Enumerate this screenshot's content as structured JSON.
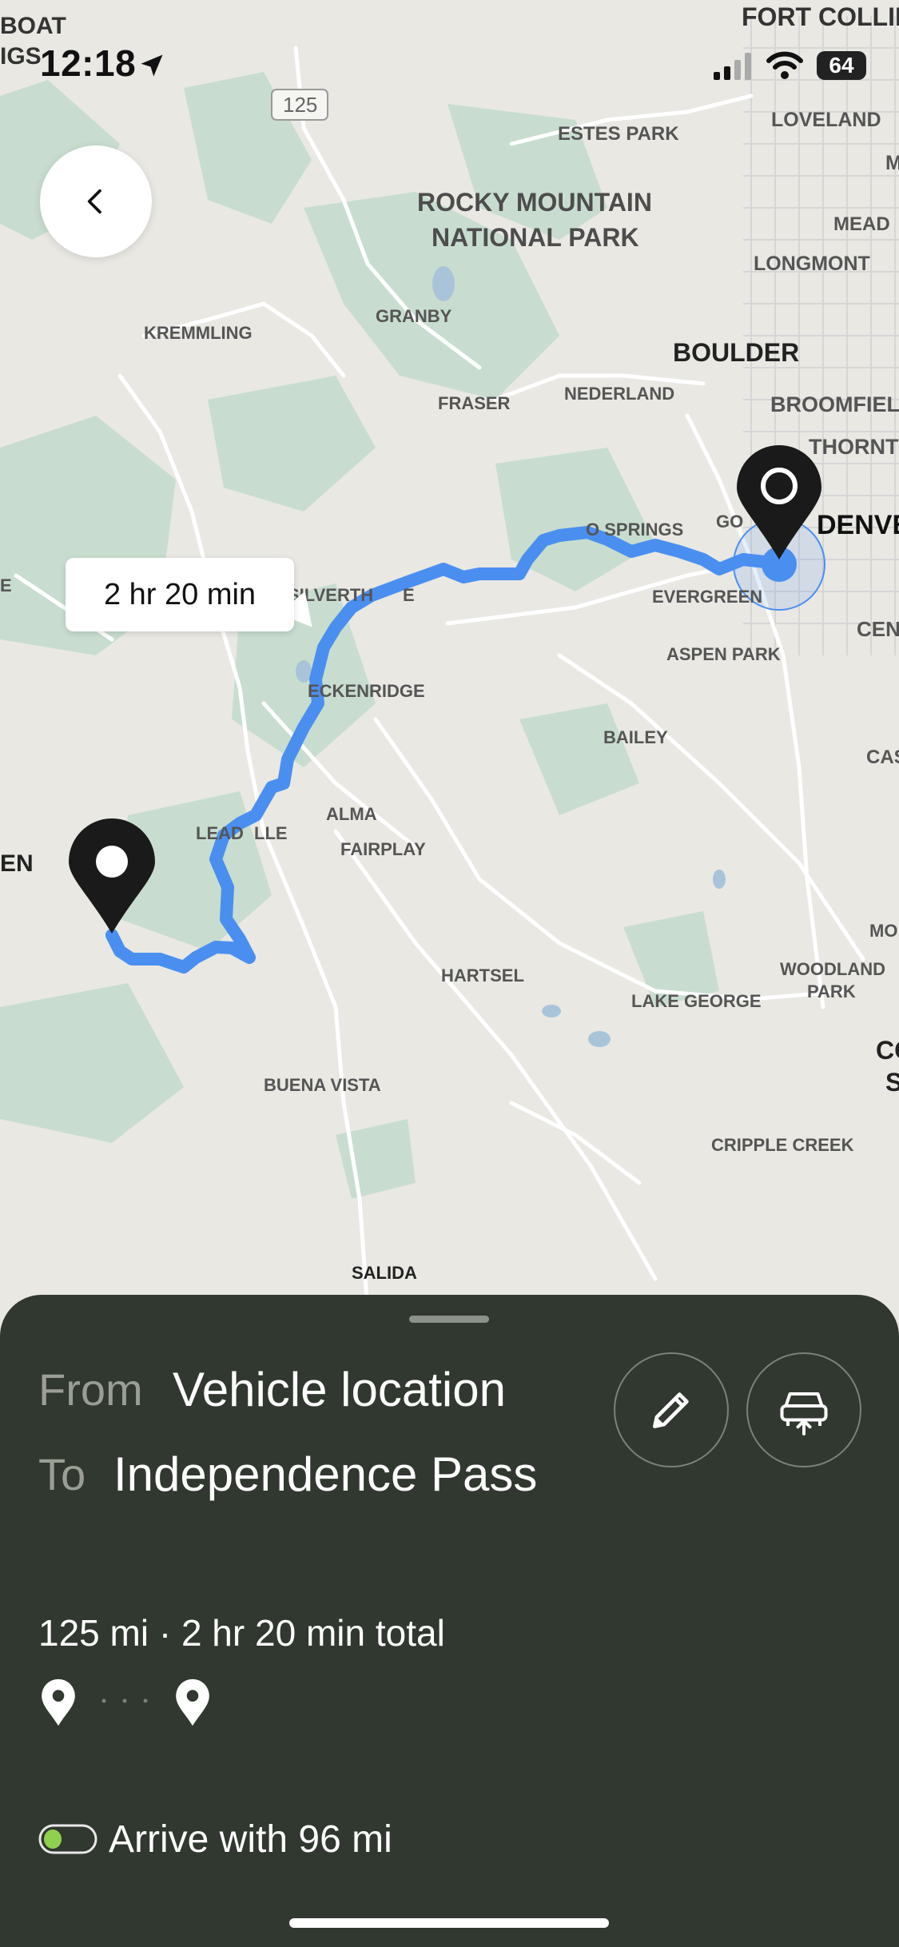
{
  "status_bar": {
    "time": "12:18",
    "battery": "64"
  },
  "map": {
    "labels": {
      "boat": "BOAT",
      "igs": "IGS",
      "fort_collins": "FORT COLLINS",
      "loveland": "LOVELAND",
      "estes_park": "ESTES PARK",
      "rmnp_1": "ROCKY MOUNTAIN",
      "rmnp_2": "NATIONAL PARK",
      "mead": "MEAD",
      "longmont": "LONGMONT",
      "granby": "GRANBY",
      "kremmling": "KREMMLING",
      "boulder": "BOULDER",
      "broomfield": "BROOMFIELD",
      "fraser": "FRASER",
      "nederland": "NEDERLAND",
      "thornton": "THORNTO",
      "denver": "DENVE",
      "idaho_springs": "O SPRINGS",
      "golden": "GO",
      "silverthorne": "SILVERTH",
      "silverthorne_end": "E",
      "evergreen": "EVERGREEN",
      "centennial": "CENT",
      "aspen_park": "ASPEN PARK",
      "breckenridge": "ECKENRIDGE",
      "bailey": "BAILEY",
      "castle": "CAS",
      "leadville_a": "LEAD",
      "leadville_b": "LLE",
      "alma": "ALMA",
      "fairplay": "FAIRPLAY",
      "aspen": "EN",
      "monument": "MO",
      "woodland_1": "WOODLAND",
      "woodland_2": "PARK",
      "hartsel": "HARTSEL",
      "lake_george": "LAKE GEORGE",
      "cos_1": "CO",
      "cos_2": "S",
      "buena_vista": "BUENA VISTA",
      "cripple_creek": "CRIPPLE CREEK",
      "salida": "SALIDA",
      "edge_e": "E",
      "edge_m": "M",
      "highway": "125"
    },
    "eta_label": "2 hr 20 min",
    "colors": {
      "route": "#4a8ff0",
      "land": "#e9e8e3",
      "forest": "#c5dccd",
      "water": "#a9c4d9",
      "road": "#ffffff"
    }
  },
  "trip": {
    "from_label": "From",
    "from_value": "Vehicle location",
    "to_label": "To",
    "to_value": "Independence Pass",
    "summary": "125 mi · 2 hr 20 min total",
    "arrive": "Arrive with 96 mi",
    "battery_color": "#8fd14f"
  },
  "icons": [
    "location-arrow-icon",
    "signal-icon",
    "wifi-icon",
    "chevron-left-icon",
    "pencil-icon",
    "vehicle-share-icon",
    "pin-icon",
    "battery-icon"
  ]
}
